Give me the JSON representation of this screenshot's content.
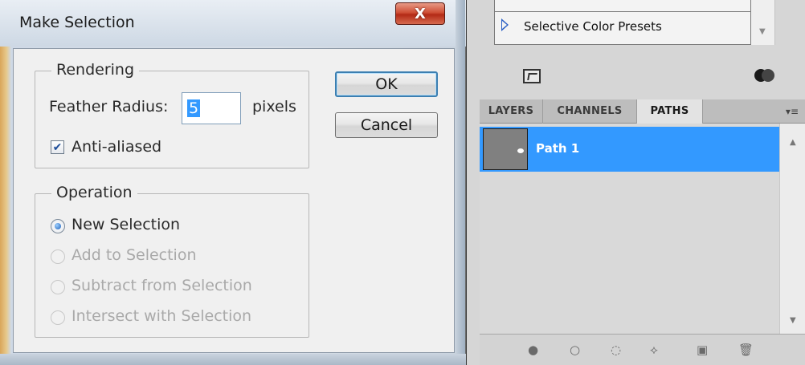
{
  "dialog": {
    "title": "Make Selection",
    "close_glyph": "X",
    "rendering": {
      "legend": "Rendering",
      "feather_label": "Feather Radius:",
      "feather_value": "5",
      "feather_unit": "pixels",
      "antialias_label": "Anti-aliased",
      "antialias_checked": true
    },
    "operation": {
      "legend": "Operation",
      "options": [
        {
          "label": "New Selection",
          "selected": true,
          "enabled": true
        },
        {
          "label": "Add to Selection",
          "selected": false,
          "enabled": false
        },
        {
          "label": "Subtract from Selection",
          "selected": false,
          "enabled": false
        },
        {
          "label": "Intersect with Selection",
          "selected": false,
          "enabled": false
        }
      ]
    },
    "buttons": {
      "ok": "OK",
      "cancel": "Cancel"
    }
  },
  "panel": {
    "presets_item": "Selective Color Presets",
    "tabs": [
      "LAYERS",
      "CHANNELS",
      "PATHS"
    ],
    "active_tab": "PATHS",
    "paths": [
      {
        "name": "Path 1",
        "selected": true
      }
    ],
    "bottom_icons": [
      "fill-path-icon",
      "stroke-path-icon",
      "load-selection-icon",
      "make-work-path-icon",
      "new-path-icon",
      "delete-path-icon"
    ],
    "colors": {
      "selection_blue": "#3399ff",
      "panel_gray": "#d6d6d6"
    }
  }
}
